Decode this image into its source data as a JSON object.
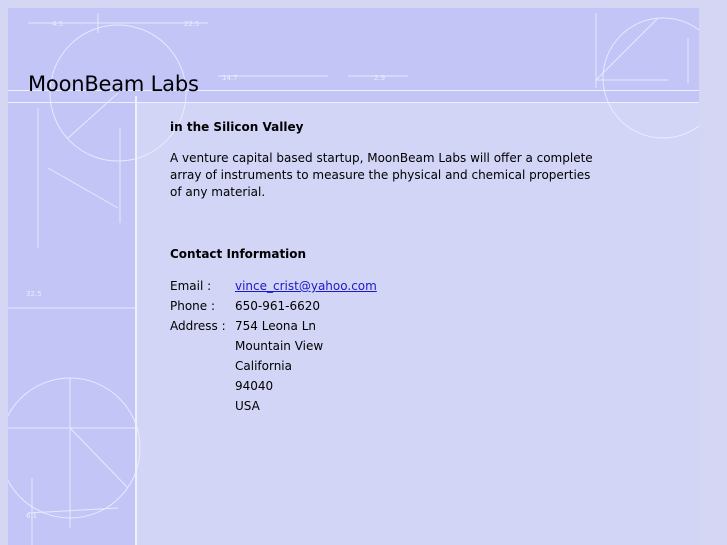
{
  "header": {
    "site_title": "MoonBeam Labs"
  },
  "intro": {
    "heading": "in the Silicon Valley",
    "text": "A venture capital based startup, MoonBeam Labs will offer a complete array of instruments to measure the physical and chemical properties of any material."
  },
  "contact": {
    "heading": "Contact Information",
    "email_label": "Email :",
    "email": "vince_crist@yahoo.com",
    "phone_label": "Phone :",
    "phone": "650-961-6620",
    "address_label": "Address :",
    "address": [
      "754 Leona Ln",
      "Mountain View",
      "California",
      "94040",
      "USA"
    ]
  },
  "decor": {
    "labels": [
      "4.5",
      "22.5",
      "14.7",
      "2.9",
      "32.5",
      "6.1"
    ],
    "colors": {
      "background": "#d2d5f5",
      "band": "#c3c5f7",
      "lines": "#eef0ff",
      "link": "#1a1acc"
    }
  }
}
